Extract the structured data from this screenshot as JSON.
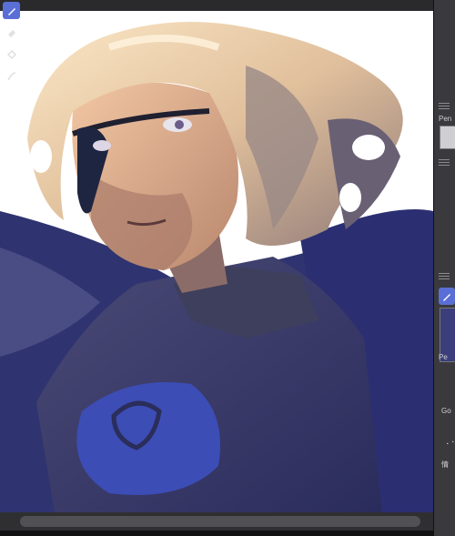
{
  "tools": [
    {
      "name": "pen-icon",
      "active": true
    },
    {
      "name": "eraser-icon",
      "active": false
    },
    {
      "name": "fill-icon",
      "active": false
    },
    {
      "name": "airbrush-icon",
      "active": false
    }
  ],
  "panels": {
    "sub_tool_label": "Pen",
    "brush_preview_label": "Pe",
    "bottom_label_1": "Go",
    "bottom_label_2": "情"
  },
  "colors": {
    "accent": "#5a6fd6",
    "panel_bg": "#3a3a3e"
  }
}
